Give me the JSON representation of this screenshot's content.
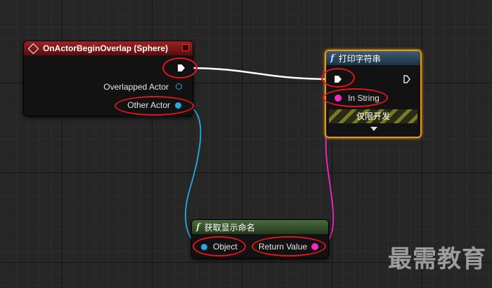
{
  "event_node": {
    "title": "OnActorBeginOverlap (Sphere)",
    "pins": {
      "overlapped_actor": "Overlapped Actor",
      "other_actor": "Other Actor"
    }
  },
  "print_node": {
    "function_glyph": "f",
    "title": "打印字符串",
    "pins": {
      "in_string": "In String"
    },
    "dev_only_label": "仅限开发"
  },
  "getter_node": {
    "function_glyph": "f",
    "title": "获取显示命名",
    "pins": {
      "object": "Object",
      "return_value": "Return Value"
    }
  },
  "watermark": "最需教育",
  "colors": {
    "event_header": "#7a1515",
    "function_header": "#2f4a60",
    "pure_function_header": "#3b5a2e",
    "object_pin": "#28a6e6",
    "string_pin": "#f02bc2",
    "exec_wire": "#ffffff",
    "selection_outline": "#e89a16",
    "highlight_ring": "#e0161c"
  },
  "icons": {
    "event": "event-diamond-icon",
    "function": "function-f-icon",
    "exec_pin": "exec-arrow-icon"
  }
}
